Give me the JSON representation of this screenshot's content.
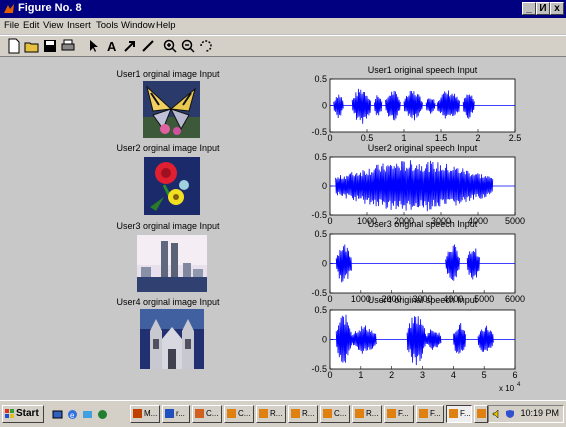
{
  "window": {
    "title": "Figure No. 8",
    "controls": [
      "_",
      "И",
      "x"
    ]
  },
  "menu": [
    "File",
    "Edit",
    "View",
    "Insert",
    "Tools",
    "Window",
    "Help"
  ],
  "toolbar": [
    "new-figure",
    "open-file",
    "save",
    "print",
    "select-arrow",
    "insert-text",
    "insert-arrow",
    "insert-line",
    "zoom-in",
    "zoom-out",
    "rotate-3d"
  ],
  "images": [
    {
      "title": "User1 orginal image Input",
      "subject": "butterfly"
    },
    {
      "title": "User2 orginal image Input",
      "subject": "flowers"
    },
    {
      "title": "User3 orginal image Input",
      "subject": "city skyline"
    },
    {
      "title": "User4 orginal image Input",
      "subject": "cathedral"
    }
  ],
  "plot_titles": [
    "User1 original speech Input",
    "User2 original speech Input",
    "User3 original speech Input",
    "User4 original speech Input"
  ],
  "chart_data": [
    {
      "type": "line",
      "title": "User1 original speech Input",
      "xlim": [
        0,
        2.5
      ],
      "ylim": [
        -0.5,
        0.5
      ],
      "xticks": [
        "0",
        "0.5",
        "1",
        "1.5",
        "2",
        "2.5"
      ],
      "yticks": [
        "0.5",
        "0",
        "-0.5"
      ],
      "color": "#0000ff",
      "bursts": [
        [
          0.05,
          0.18,
          0.25
        ],
        [
          0.3,
          0.55,
          0.35
        ],
        [
          0.6,
          0.7,
          0.25
        ],
        [
          0.75,
          0.95,
          0.3
        ],
        [
          1.0,
          1.25,
          0.3
        ],
        [
          1.3,
          1.42,
          0.2
        ],
        [
          1.45,
          1.75,
          0.3
        ],
        [
          1.8,
          1.95,
          0.25
        ]
      ]
    },
    {
      "type": "line",
      "title": "User2 original speech Input",
      "xlim": [
        0,
        5000
      ],
      "ylim": [
        -0.5,
        0.5
      ],
      "xticks": [
        "0",
        "1000",
        "2000",
        "3000",
        "4000",
        "5000"
      ],
      "yticks": [
        "0.5",
        "0",
        "-0.5"
      ],
      "color": "#0000ff",
      "bursts": [
        [
          150,
          4400,
          0.45
        ]
      ]
    },
    {
      "type": "line",
      "title": "User3 original speech Input",
      "xlim": [
        0,
        6000
      ],
      "ylim": [
        -0.5,
        0.5
      ],
      "xticks": [
        "0",
        "1000",
        "2000",
        "3000",
        "4000",
        "5000",
        "6000"
      ],
      "yticks": [
        "0.5",
        "0",
        "-0.5"
      ],
      "color": "#0000ff",
      "bursts": [
        [
          200,
          700,
          0.35
        ],
        [
          3750,
          4200,
          0.35
        ],
        [
          4450,
          4850,
          0.3
        ]
      ]
    },
    {
      "type": "line",
      "title": "User4 original speech Input",
      "xlim": [
        0,
        60000
      ],
      "ylim": [
        -0.5,
        0.5
      ],
      "xticks": [
        "0",
        "1",
        "2",
        "3",
        "4",
        "5",
        "6"
      ],
      "xscale_label": "x 10",
      "xscale_exp": "4",
      "yticks": [
        "0.5",
        "0",
        "-0.5"
      ],
      "color": "#0000ff",
      "bursts": [
        [
          2000,
          7000,
          0.45
        ],
        [
          7000,
          15000,
          0.25
        ],
        [
          25000,
          31000,
          0.45
        ],
        [
          31000,
          36000,
          0.2
        ],
        [
          40000,
          44000,
          0.3
        ],
        [
          48000,
          53000,
          0.25
        ]
      ]
    }
  ],
  "taskbar": {
    "start": "Start",
    "buttons": [
      "M...",
      "r...",
      "C...",
      "C...",
      "R...",
      "R...",
      "C...",
      "R...",
      "F...",
      "F...",
      "F...",
      "F..."
    ],
    "clock": "10:19 PM"
  }
}
